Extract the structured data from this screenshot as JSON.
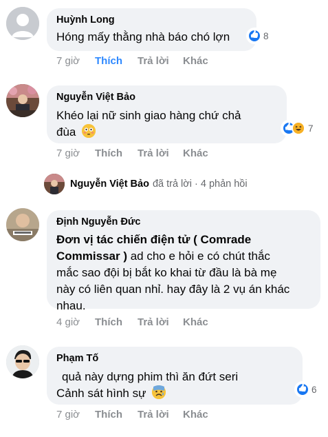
{
  "comments": [
    {
      "author": "Huỳnh Long",
      "text": "Hóng mấy thằng nhà báo chó lợn",
      "reaction_count": "8",
      "time": "7 giờ",
      "like": "Thích",
      "reply": "Trả lời",
      "more": "Khác"
    },
    {
      "author": "Nguyễn Việt Bảo",
      "text_line1": "Khéo lại nữ sinh giao hàng chứ chả",
      "text_line2": "đùa",
      "reaction_count": "7",
      "time": "7 giờ",
      "like": "Thích",
      "reply": "Trả lời",
      "more": "Khác"
    },
    {
      "author": "Định Nguyễn Đức",
      "bold_line1": "Đơn vị tác chiến điện tử ( Comrade",
      "bold_line2": "Commissar )",
      "text_line2": " ad cho e hỏi e có chút thắc",
      "text_line3": "mắc sao đội bị bắt ko khai từ đầu là bà mẹ",
      "text_line4": "này có liên quan nhỉ. hay đây là 2 vụ án khác",
      "text_line5": "nhau.",
      "time": "4 giờ",
      "like": "Thích",
      "reply": "Trả lời",
      "more": "Khác"
    },
    {
      "author": "Phạm Tố",
      "text_line1": "quả này dựng phim thì ăn đứt seri",
      "text_line2": "Cảnh sát hình sự",
      "reaction_count": "6",
      "time": "7 giờ",
      "like": "Thích",
      "reply": "Trả lời",
      "more": "Khác"
    }
  ],
  "reply_summary": {
    "author": "Nguyễn Việt Bảo",
    "verb": "đã trả lời",
    "separator": "·",
    "count": "4 phản hồi"
  },
  "colors": {
    "bubble": "#f0f2f5",
    "meta": "#8a8d91",
    "liked": "#2d88ff",
    "like_reaction": "#1877f2",
    "haha_reaction": "#f7b125"
  },
  "icons": [
    "like-reaction-icon",
    "haha-reaction-icon",
    "flushed-face-emoji",
    "anxious-face-emoji",
    "reply-arrow-icon"
  ]
}
